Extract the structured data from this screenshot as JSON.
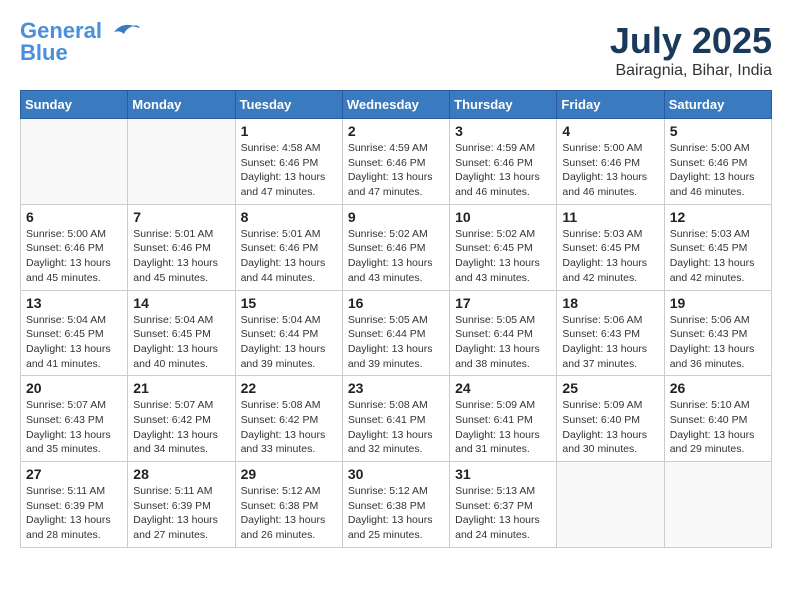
{
  "header": {
    "logo_line1": "General",
    "logo_line2": "Blue",
    "month_year": "July 2025",
    "location": "Bairagnia, Bihar, India"
  },
  "weekdays": [
    "Sunday",
    "Monday",
    "Tuesday",
    "Wednesday",
    "Thursday",
    "Friday",
    "Saturday"
  ],
  "weeks": [
    [
      {
        "day": "",
        "info": ""
      },
      {
        "day": "",
        "info": ""
      },
      {
        "day": "1",
        "info": "Sunrise: 4:58 AM\nSunset: 6:46 PM\nDaylight: 13 hours and 47 minutes."
      },
      {
        "day": "2",
        "info": "Sunrise: 4:59 AM\nSunset: 6:46 PM\nDaylight: 13 hours and 47 minutes."
      },
      {
        "day": "3",
        "info": "Sunrise: 4:59 AM\nSunset: 6:46 PM\nDaylight: 13 hours and 46 minutes."
      },
      {
        "day": "4",
        "info": "Sunrise: 5:00 AM\nSunset: 6:46 PM\nDaylight: 13 hours and 46 minutes."
      },
      {
        "day": "5",
        "info": "Sunrise: 5:00 AM\nSunset: 6:46 PM\nDaylight: 13 hours and 46 minutes."
      }
    ],
    [
      {
        "day": "6",
        "info": "Sunrise: 5:00 AM\nSunset: 6:46 PM\nDaylight: 13 hours and 45 minutes."
      },
      {
        "day": "7",
        "info": "Sunrise: 5:01 AM\nSunset: 6:46 PM\nDaylight: 13 hours and 45 minutes."
      },
      {
        "day": "8",
        "info": "Sunrise: 5:01 AM\nSunset: 6:46 PM\nDaylight: 13 hours and 44 minutes."
      },
      {
        "day": "9",
        "info": "Sunrise: 5:02 AM\nSunset: 6:46 PM\nDaylight: 13 hours and 43 minutes."
      },
      {
        "day": "10",
        "info": "Sunrise: 5:02 AM\nSunset: 6:45 PM\nDaylight: 13 hours and 43 minutes."
      },
      {
        "day": "11",
        "info": "Sunrise: 5:03 AM\nSunset: 6:45 PM\nDaylight: 13 hours and 42 minutes."
      },
      {
        "day": "12",
        "info": "Sunrise: 5:03 AM\nSunset: 6:45 PM\nDaylight: 13 hours and 42 minutes."
      }
    ],
    [
      {
        "day": "13",
        "info": "Sunrise: 5:04 AM\nSunset: 6:45 PM\nDaylight: 13 hours and 41 minutes."
      },
      {
        "day": "14",
        "info": "Sunrise: 5:04 AM\nSunset: 6:45 PM\nDaylight: 13 hours and 40 minutes."
      },
      {
        "day": "15",
        "info": "Sunrise: 5:04 AM\nSunset: 6:44 PM\nDaylight: 13 hours and 39 minutes."
      },
      {
        "day": "16",
        "info": "Sunrise: 5:05 AM\nSunset: 6:44 PM\nDaylight: 13 hours and 39 minutes."
      },
      {
        "day": "17",
        "info": "Sunrise: 5:05 AM\nSunset: 6:44 PM\nDaylight: 13 hours and 38 minutes."
      },
      {
        "day": "18",
        "info": "Sunrise: 5:06 AM\nSunset: 6:43 PM\nDaylight: 13 hours and 37 minutes."
      },
      {
        "day": "19",
        "info": "Sunrise: 5:06 AM\nSunset: 6:43 PM\nDaylight: 13 hours and 36 minutes."
      }
    ],
    [
      {
        "day": "20",
        "info": "Sunrise: 5:07 AM\nSunset: 6:43 PM\nDaylight: 13 hours and 35 minutes."
      },
      {
        "day": "21",
        "info": "Sunrise: 5:07 AM\nSunset: 6:42 PM\nDaylight: 13 hours and 34 minutes."
      },
      {
        "day": "22",
        "info": "Sunrise: 5:08 AM\nSunset: 6:42 PM\nDaylight: 13 hours and 33 minutes."
      },
      {
        "day": "23",
        "info": "Sunrise: 5:08 AM\nSunset: 6:41 PM\nDaylight: 13 hours and 32 minutes."
      },
      {
        "day": "24",
        "info": "Sunrise: 5:09 AM\nSunset: 6:41 PM\nDaylight: 13 hours and 31 minutes."
      },
      {
        "day": "25",
        "info": "Sunrise: 5:09 AM\nSunset: 6:40 PM\nDaylight: 13 hours and 30 minutes."
      },
      {
        "day": "26",
        "info": "Sunrise: 5:10 AM\nSunset: 6:40 PM\nDaylight: 13 hours and 29 minutes."
      }
    ],
    [
      {
        "day": "27",
        "info": "Sunrise: 5:11 AM\nSunset: 6:39 PM\nDaylight: 13 hours and 28 minutes."
      },
      {
        "day": "28",
        "info": "Sunrise: 5:11 AM\nSunset: 6:39 PM\nDaylight: 13 hours and 27 minutes."
      },
      {
        "day": "29",
        "info": "Sunrise: 5:12 AM\nSunset: 6:38 PM\nDaylight: 13 hours and 26 minutes."
      },
      {
        "day": "30",
        "info": "Sunrise: 5:12 AM\nSunset: 6:38 PM\nDaylight: 13 hours and 25 minutes."
      },
      {
        "day": "31",
        "info": "Sunrise: 5:13 AM\nSunset: 6:37 PM\nDaylight: 13 hours and 24 minutes."
      },
      {
        "day": "",
        "info": ""
      },
      {
        "day": "",
        "info": ""
      }
    ]
  ]
}
